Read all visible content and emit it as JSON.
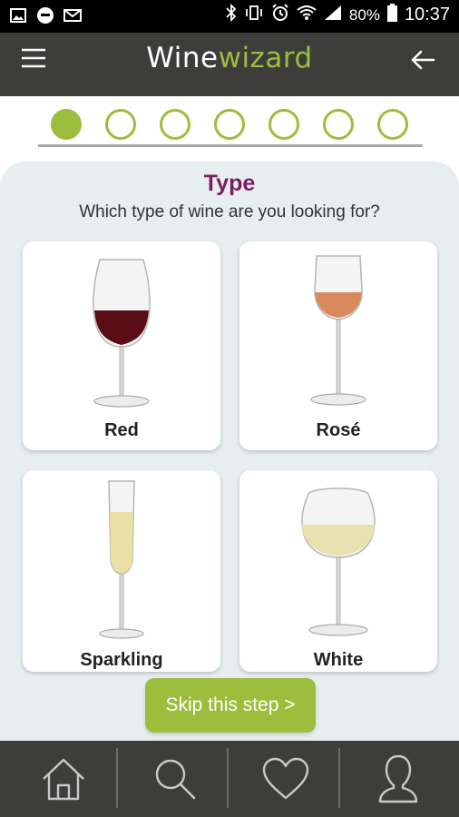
{
  "status_bar": {
    "battery": "80%",
    "time": "10:37",
    "left_icons": [
      "image-icon",
      "sms-icon",
      "mail-icon"
    ],
    "right_icons": [
      "bluetooth-icon",
      "vibrate-icon",
      "alarm-icon",
      "wifi-icon",
      "signal-icon",
      "battery-icon"
    ]
  },
  "header": {
    "logo_part1": "Wine",
    "logo_part2": "wizard",
    "menu_icon": "hamburger-menu-icon",
    "back_icon": "back-arrow-icon"
  },
  "progress": {
    "total_steps": 7,
    "current_step": 1
  },
  "question": {
    "title": "Type",
    "subtitle": "Which type of wine are you looking for?"
  },
  "options": [
    {
      "label": "Red"
    },
    {
      "label": "Rosé"
    },
    {
      "label": "Sparkling"
    },
    {
      "label": "White"
    }
  ],
  "skip_button": "Skip this step >",
  "bottom_nav": [
    {
      "icon": "home-icon"
    },
    {
      "icon": "search-icon"
    },
    {
      "icon": "heart-icon"
    },
    {
      "icon": "profile-icon"
    }
  ],
  "colors": {
    "accent": "#9dbd3c",
    "title": "#7b1e5e",
    "bar": "#3d3d3b",
    "panel": "#e7eef0"
  }
}
